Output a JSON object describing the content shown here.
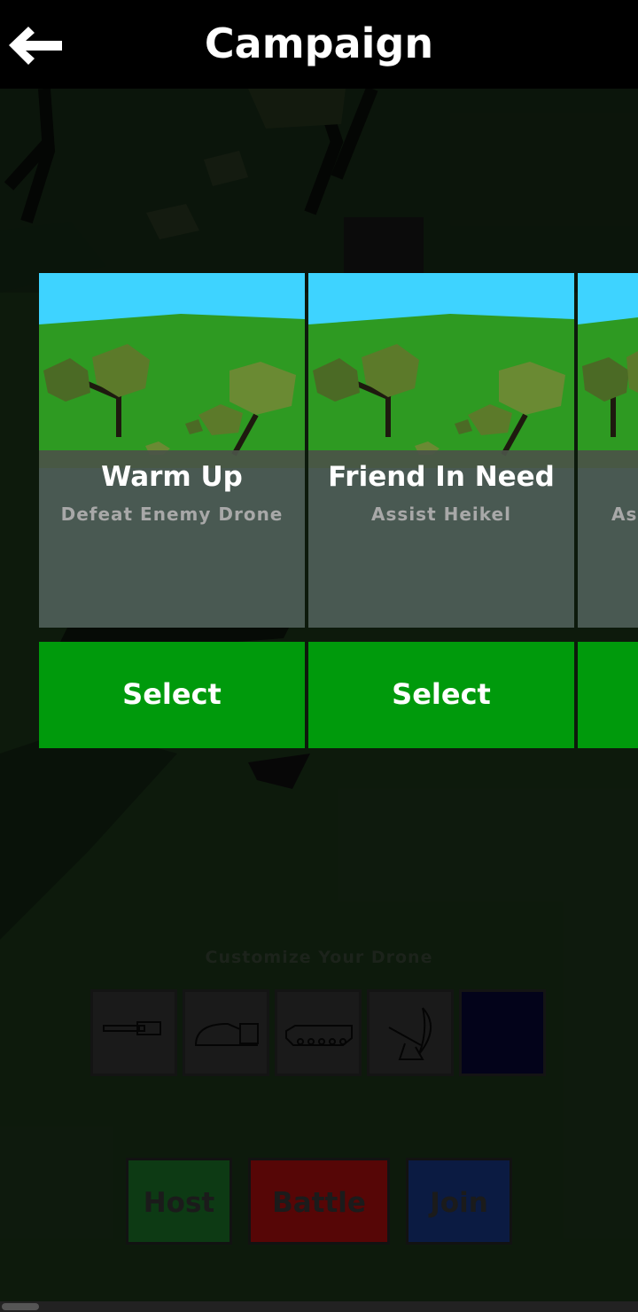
{
  "header": {
    "title": "Campaign",
    "back_icon": "back-arrow-icon"
  },
  "missions": [
    {
      "name": "Warm Up",
      "objective": "Defeat Enemy Drone",
      "select_label": "Select"
    },
    {
      "name": "Friend In Need",
      "objective": "Assist Heikel",
      "select_label": "Select"
    },
    {
      "name": "",
      "objective": "As",
      "select_label": ""
    }
  ],
  "customize": {
    "label": "Customize Your Drone",
    "slots": [
      "weapon-gun-icon",
      "dome-turret-icon",
      "tank-chassis-icon",
      "radar-dish-icon",
      "empty-slot"
    ]
  },
  "modes": {
    "host": "Host",
    "battle": "Battle",
    "join": "Join"
  },
  "colors": {
    "select": "#009a0c",
    "sky": "#3ed3ff",
    "grass": "#2e9a22",
    "host": "#0d3a14",
    "battle": "#560606",
    "join": "#0b1b42"
  }
}
